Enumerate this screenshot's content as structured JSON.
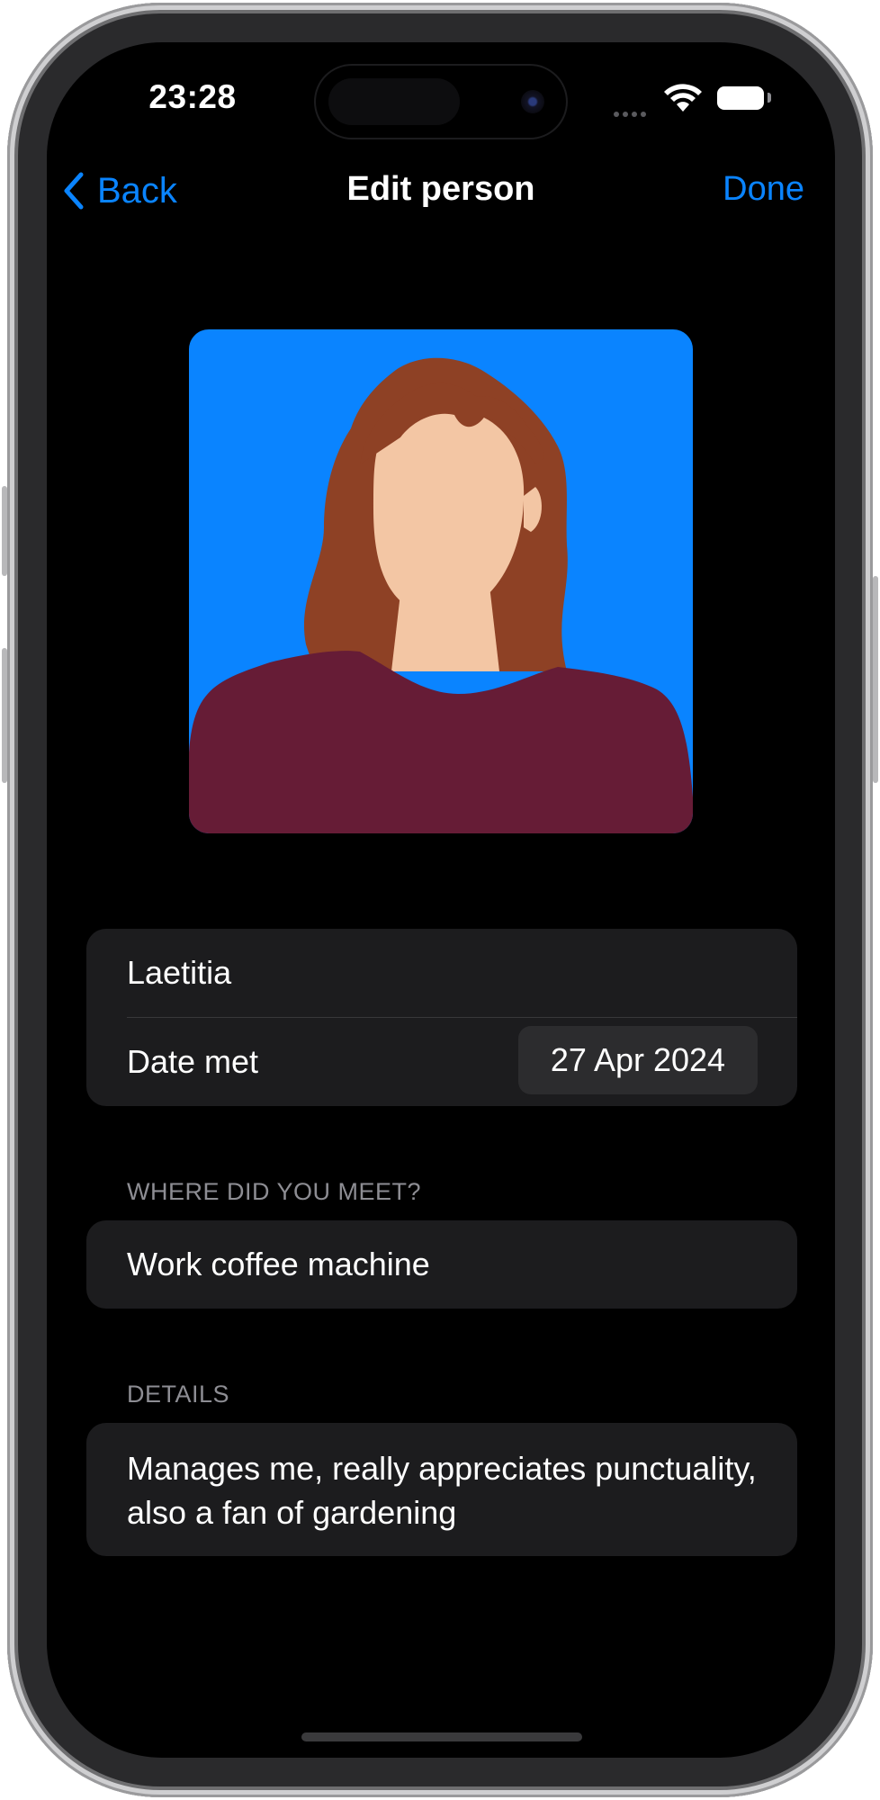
{
  "status_bar": {
    "time": "23:28"
  },
  "nav": {
    "back_label": "Back",
    "title": "Edit person",
    "done_label": "Done"
  },
  "avatar": {
    "icon": "person-illustration",
    "background": "#0a84ff",
    "hair": "#8e4125",
    "skin": "#f3c6a4",
    "shirt": "#661c36"
  },
  "form": {
    "name_value": "Laetitia",
    "date_label": "Date met",
    "date_value": "27 Apr 2024",
    "where_header": "WHERE DID YOU MEET?",
    "where_value": "Work coffee machine",
    "details_header": "DETAILS",
    "details_value": "Manages me, really appreciates punctuality, also a fan of gardening"
  },
  "colors": {
    "accent": "#0a84ff",
    "cell": "#1c1c1e",
    "background": "#000000"
  }
}
